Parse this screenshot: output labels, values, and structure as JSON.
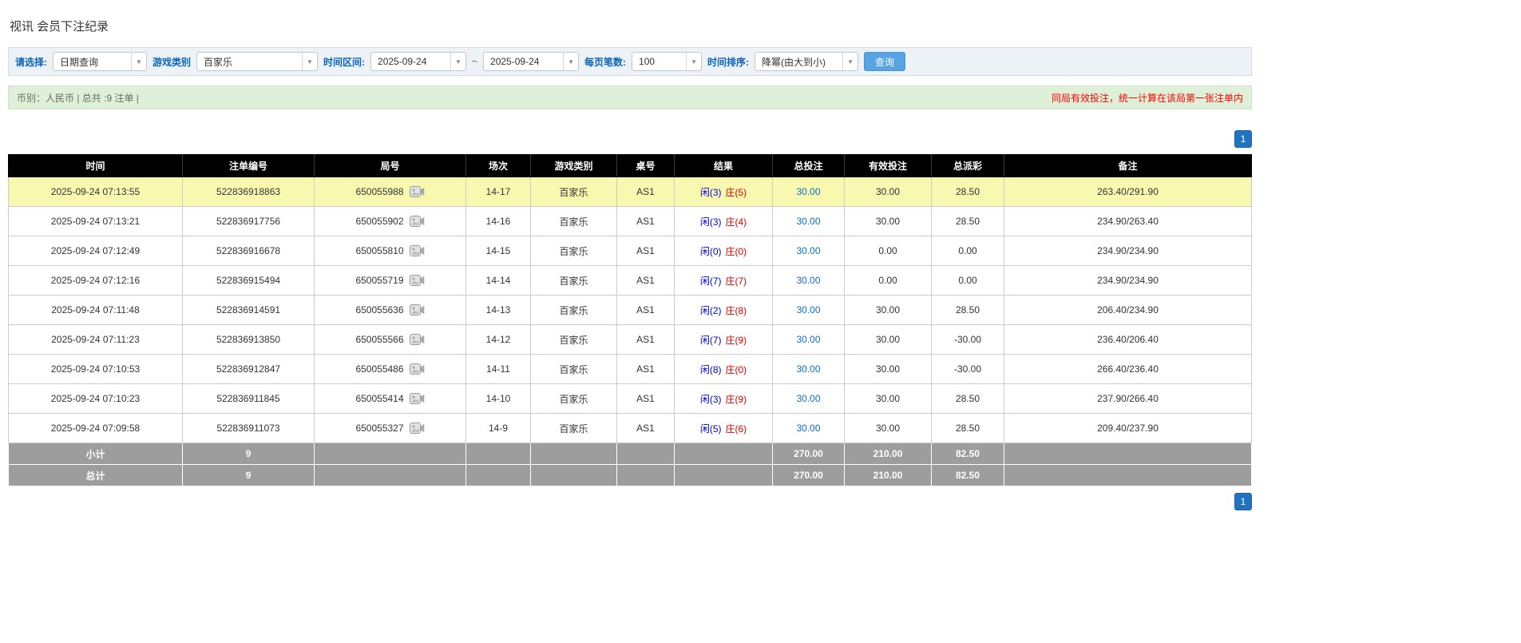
{
  "page": {
    "title": "视讯 会员下注纪录"
  },
  "filters": {
    "mode_label": "请选择:",
    "mode_value": "日期查询",
    "game_type_label": "游戏类别",
    "game_type_value": "百家乐",
    "date_range_label": "时间区间:",
    "date_from": "2025-09-24",
    "date_separator": "~",
    "date_to": "2025-09-24",
    "page_size_label": "每页笔数:",
    "page_size_value": "100",
    "sort_label": "时间排序:",
    "sort_value": "降幂(由大到小)",
    "search_button": "查询"
  },
  "summary": {
    "left": "币别：人民币 | 总共 :9 注单 |",
    "right": "同局有效投注，统一计算在该局第一张注单内"
  },
  "pagination": {
    "page": "1"
  },
  "table": {
    "headers": [
      "时间",
      "注单编号",
      "局号",
      "场次",
      "游戏类别",
      "桌号",
      "结果",
      "总投注",
      "有效投注",
      "总派彩",
      "备注"
    ],
    "rows": [
      {
        "time": "2025-09-24 07:13:55",
        "bet_id": "522836918863",
        "round": "650055988",
        "session": "14-17",
        "game": "百家乐",
        "table_no": "AS1",
        "player": "闲(3)",
        "banker": "庄(5)",
        "total_bet": "30.00",
        "valid_bet": "30.00",
        "payout": "28.50",
        "note": "263.40/291.90",
        "highlight": true
      },
      {
        "time": "2025-09-24 07:13:21",
        "bet_id": "522836917756",
        "round": "650055902",
        "session": "14-16",
        "game": "百家乐",
        "table_no": "AS1",
        "player": "闲(3)",
        "banker": "庄(4)",
        "total_bet": "30.00",
        "valid_bet": "30.00",
        "payout": "28.50",
        "note": "234.90/263.40",
        "highlight": false
      },
      {
        "time": "2025-09-24 07:12:49",
        "bet_id": "522836916678",
        "round": "650055810",
        "session": "14-15",
        "game": "百家乐",
        "table_no": "AS1",
        "player": "闲(0)",
        "banker": "庄(0)",
        "total_bet": "30.00",
        "valid_bet": "0.00",
        "payout": "0.00",
        "note": "234.90/234.90",
        "highlight": false
      },
      {
        "time": "2025-09-24 07:12:16",
        "bet_id": "522836915494",
        "round": "650055719",
        "session": "14-14",
        "game": "百家乐",
        "table_no": "AS1",
        "player": "闲(7)",
        "banker": "庄(7)",
        "total_bet": "30.00",
        "valid_bet": "0.00",
        "payout": "0.00",
        "note": "234.90/234.90",
        "highlight": false
      },
      {
        "time": "2025-09-24 07:11:48",
        "bet_id": "522836914591",
        "round": "650055636",
        "session": "14-13",
        "game": "百家乐",
        "table_no": "AS1",
        "player": "闲(2)",
        "banker": "庄(8)",
        "total_bet": "30.00",
        "valid_bet": "30.00",
        "payout": "28.50",
        "note": "206.40/234.90",
        "highlight": false
      },
      {
        "time": "2025-09-24 07:11:23",
        "bet_id": "522836913850",
        "round": "650055566",
        "session": "14-12",
        "game": "百家乐",
        "table_no": "AS1",
        "player": "闲(7)",
        "banker": "庄(9)",
        "total_bet": "30.00",
        "valid_bet": "30.00",
        "payout": "-30.00",
        "note": "236.40/206.40",
        "highlight": false
      },
      {
        "time": "2025-09-24 07:10:53",
        "bet_id": "522836912847",
        "round": "650055486",
        "session": "14-11",
        "game": "百家乐",
        "table_no": "AS1",
        "player": "闲(8)",
        "banker": "庄(0)",
        "total_bet": "30.00",
        "valid_bet": "30.00",
        "payout": "-30.00",
        "note": "266.40/236.40",
        "highlight": false
      },
      {
        "time": "2025-09-24 07:10:23",
        "bet_id": "522836911845",
        "round": "650055414",
        "session": "14-10",
        "game": "百家乐",
        "table_no": "AS1",
        "player": "闲(3)",
        "banker": "庄(9)",
        "total_bet": "30.00",
        "valid_bet": "30.00",
        "payout": "28.50",
        "note": "237.90/266.40",
        "highlight": false
      },
      {
        "time": "2025-09-24 07:09:58",
        "bet_id": "522836911073",
        "round": "650055327",
        "session": "14-9",
        "game": "百家乐",
        "table_no": "AS1",
        "player": "闲(5)",
        "banker": "庄(6)",
        "total_bet": "30.00",
        "valid_bet": "30.00",
        "payout": "28.50",
        "note": "209.40/237.90",
        "highlight": false
      }
    ],
    "subtotal": {
      "label": "小计",
      "count": "9",
      "total_bet": "270.00",
      "valid_bet": "210.00",
      "payout": "82.50"
    },
    "total": {
      "label": "总计",
      "count": "9",
      "total_bet": "270.00",
      "valid_bet": "210.00",
      "payout": "82.50"
    }
  }
}
